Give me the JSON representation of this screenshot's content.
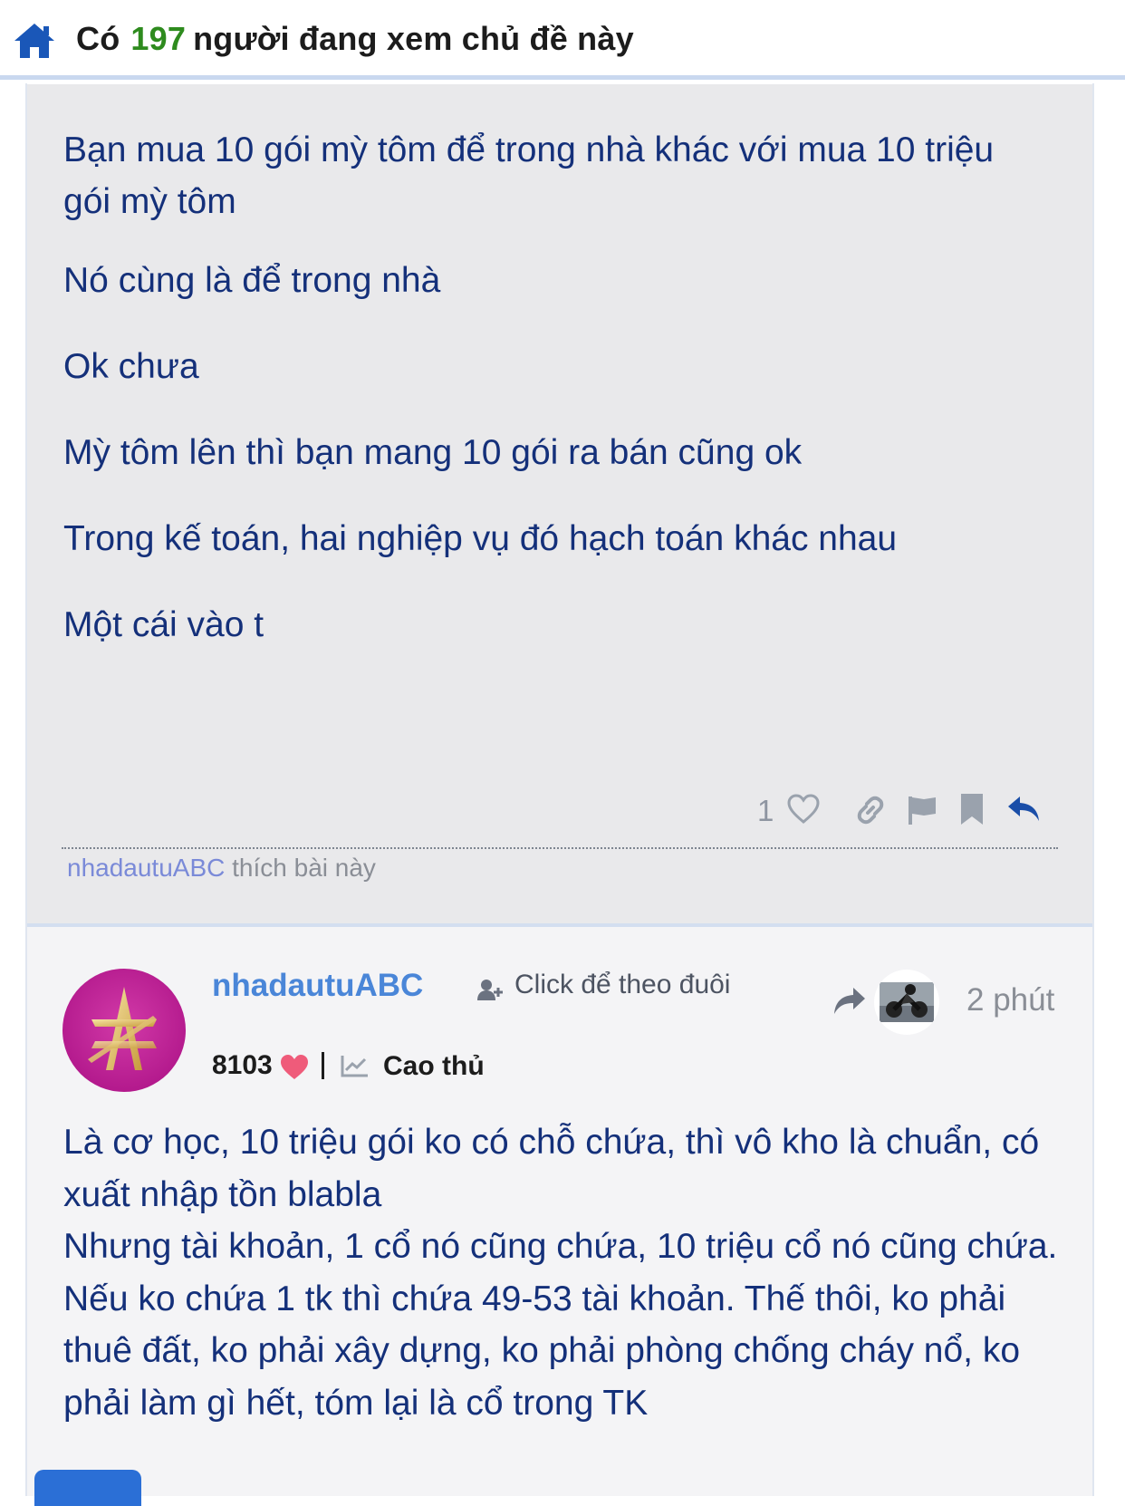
{
  "header": {
    "prefix": "Có",
    "viewer_count": "197",
    "suffix": "người đang xem chủ đề này",
    "accent_color": "#2e8b1e"
  },
  "quoted_post": {
    "lines": [
      "Bạn mua 10 gói mỳ tôm để trong nhà khác với mua 10 triệu gói mỳ tôm",
      "Nó cùng là để trong nhà",
      "Ok chưa",
      "Mỳ tôm lên thì bạn mang 10 gói ra bán cũng ok",
      "Trong kế toán, hai nghiệp vụ đó hạch toán khác nhau",
      "Một cái vào t"
    ],
    "like_count": "1",
    "liked_by_user": "nhadautuABC",
    "liked_by_text": "thích bài này",
    "icons": [
      "heart-outline-icon",
      "link-icon",
      "flag-icon",
      "bookmark-icon",
      "reply-icon"
    ]
  },
  "reply_post": {
    "username": "nhadautuABC",
    "follow_label": "Click để theo đuôi",
    "time": "2 phút",
    "points": "8103",
    "rank": "Cao thủ",
    "body": "Là cơ học, 10 triệu gói ko có chỗ chứa, thì vô kho là chuẩn, có xuất nhập tồn blabla\nNhưng tài khoản, 1 cổ nó cũng chứa, 10 triệu cổ nó cũng chứa. Nếu ko chứa 1 tk thì chứa 49-53 tài khoản. Thế thôi, ko phải thuê đất, ko phải xây dựng, ko phải phòng chống cháy nổ, ko phải làm gì hết, tóm lại là cổ trong TK",
    "accent_color": "#4a86d8"
  }
}
